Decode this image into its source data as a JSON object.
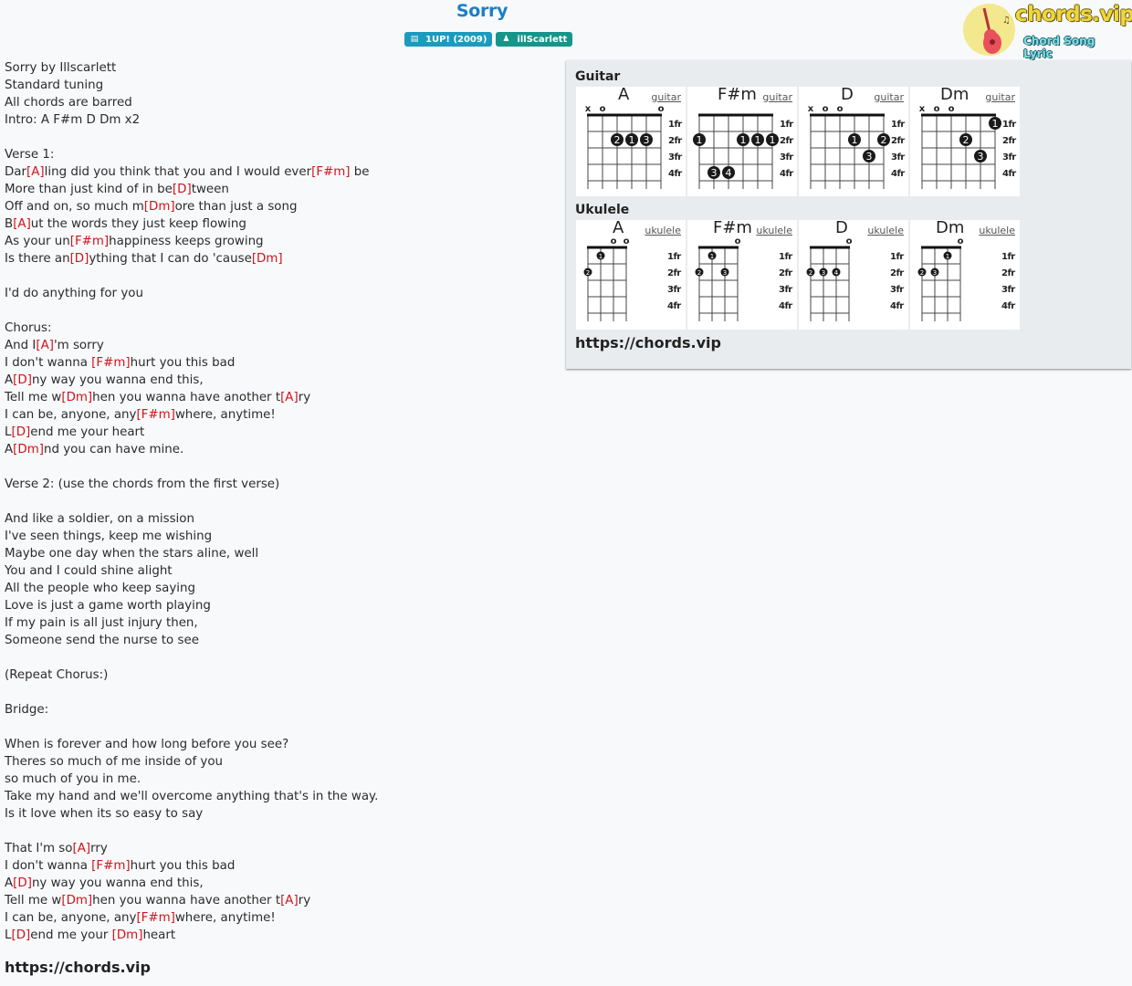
{
  "header": {
    "title": "Sorry",
    "album_badge": {
      "icon": "book-icon",
      "label": "1UP! (2009)"
    },
    "artist_badge": {
      "icon": "user-icon",
      "label": "illScarlett"
    }
  },
  "logo": {
    "title": "chords.vip",
    "subtitle": "Chord Song Lyric",
    "icon": "guitar-icon"
  },
  "colors": {
    "title": "#1b7fc4",
    "chord": "#d0141a",
    "album_badge": "#1b9bbd",
    "artist_badge": "#16958a"
  },
  "lyrics": [
    [
      {
        "t": "Sorry by Illscarlett"
      }
    ],
    [
      {
        "t": "Standard tuning"
      }
    ],
    [
      {
        "t": "All chords are barred"
      }
    ],
    [
      {
        "t": "Intro: A F#m D Dm x2"
      }
    ],
    [],
    [
      {
        "t": "Verse 1:"
      }
    ],
    [
      {
        "t": "Dar"
      },
      {
        "c": "[A]"
      },
      {
        "t": "ling did you think that you and I would ever"
      },
      {
        "c": "[F#m]"
      },
      {
        "t": " be"
      }
    ],
    [
      {
        "t": "More than just kind of in be"
      },
      {
        "c": "[D]"
      },
      {
        "t": "tween"
      }
    ],
    [
      {
        "t": "Off and on, so much m"
      },
      {
        "c": "[Dm]"
      },
      {
        "t": "ore than just a song"
      }
    ],
    [
      {
        "t": "B"
      },
      {
        "c": "[A]"
      },
      {
        "t": "ut the words they just keep flowing"
      }
    ],
    [
      {
        "t": "As your un"
      },
      {
        "c": "[F#m]"
      },
      {
        "t": "happiness keeps growing"
      }
    ],
    [
      {
        "t": "Is there an"
      },
      {
        "c": "[D]"
      },
      {
        "t": "ything that I can do 'cause"
      },
      {
        "c": "[Dm]"
      }
    ],
    [],
    [
      {
        "t": "I'd do anything for you"
      }
    ],
    [],
    [
      {
        "t": "Chorus:"
      }
    ],
    [
      {
        "t": "And I"
      },
      {
        "c": "[A]"
      },
      {
        "t": "'m sorry"
      }
    ],
    [
      {
        "t": "I don't wanna "
      },
      {
        "c": "[F#m]"
      },
      {
        "t": "hurt you this bad"
      }
    ],
    [
      {
        "t": "A"
      },
      {
        "c": "[D]"
      },
      {
        "t": "ny way you wanna end this,"
      }
    ],
    [
      {
        "t": "Tell me w"
      },
      {
        "c": "[Dm]"
      },
      {
        "t": "hen you wanna have another t"
      },
      {
        "c": "[A]"
      },
      {
        "t": "ry"
      }
    ],
    [
      {
        "t": "I can be, anyone, any"
      },
      {
        "c": "[F#m]"
      },
      {
        "t": "where, anytime!"
      }
    ],
    [
      {
        "t": "L"
      },
      {
        "c": "[D]"
      },
      {
        "t": "end me your heart"
      }
    ],
    [
      {
        "t": "A"
      },
      {
        "c": "[Dm]"
      },
      {
        "t": "nd you can have mine."
      }
    ],
    [],
    [
      {
        "t": "Verse 2: (use the chords from the first verse)"
      }
    ],
    [],
    [
      {
        "t": "And like a soldier, on a mission"
      }
    ],
    [
      {
        "t": "I've seen things, keep me wishing"
      }
    ],
    [
      {
        "t": "Maybe one day when the stars aline, well"
      }
    ],
    [
      {
        "t": "You and I could shine alight"
      }
    ],
    [
      {
        "t": "All the people who keep saying"
      }
    ],
    [
      {
        "t": "Love is just a game worth playing"
      }
    ],
    [
      {
        "t": "If my pain is all just injury then,"
      }
    ],
    [
      {
        "t": "Someone send the nurse to see"
      }
    ],
    [],
    [
      {
        "t": "(Repeat Chorus:)"
      }
    ],
    [],
    [
      {
        "t": "Bridge:"
      }
    ],
    [],
    [
      {
        "t": "When is forever and how long before you see?"
      }
    ],
    [
      {
        "t": "Theres so much of me inside of you"
      }
    ],
    [
      {
        "t": "so much of you in me."
      }
    ],
    [
      {
        "t": "Take my hand and we'll overcome anything that's in the way."
      }
    ],
    [
      {
        "t": "Is it love when its so easy to say"
      }
    ],
    [],
    [
      {
        "t": "That I'm so"
      },
      {
        "c": "[A]"
      },
      {
        "t": "rry"
      }
    ],
    [
      {
        "t": "I don't wanna "
      },
      {
        "c": "[F#m]"
      },
      {
        "t": "hurt you this bad"
      }
    ],
    [
      {
        "t": "A"
      },
      {
        "c": "[D]"
      },
      {
        "t": "ny way you wanna end this,"
      }
    ],
    [
      {
        "t": "Tell me w"
      },
      {
        "c": "[Dm]"
      },
      {
        "t": "hen you wanna have another t"
      },
      {
        "c": "[A]"
      },
      {
        "t": "ry"
      }
    ],
    [
      {
        "t": "I can be, anyone, any"
      },
      {
        "c": "[F#m]"
      },
      {
        "t": "where, anytime!"
      }
    ],
    [
      {
        "t": "L"
      },
      {
        "c": "[D]"
      },
      {
        "t": "end me your "
      },
      {
        "c": "[Dm]"
      },
      {
        "t": "heart"
      }
    ]
  ],
  "footer_link": "https://chords.vip",
  "chord_panel": {
    "guitar_heading": "Guitar",
    "ukulele_heading": "Ukulele",
    "link": "https://chords.vip",
    "fret_labels": [
      "1fr",
      "2fr",
      "3fr",
      "4fr"
    ],
    "guitar": [
      {
        "name": "A",
        "type": "guitar",
        "markers": [
          "x",
          "o",
          "",
          "",
          "",
          "o"
        ],
        "dots": [
          {
            "string": 3,
            "fret": 2,
            "finger": "2"
          },
          {
            "string": 4,
            "fret": 2,
            "finger": "1"
          },
          {
            "string": 5,
            "fret": 2,
            "finger": "3"
          }
        ]
      },
      {
        "name": "F#m",
        "type": "guitar",
        "markers": [
          "",
          "",
          "",
          "",
          "",
          ""
        ],
        "dots": [
          {
            "string": 1,
            "fret": 2,
            "finger": "1"
          },
          {
            "string": 2,
            "fret": 4,
            "finger": "3"
          },
          {
            "string": 3,
            "fret": 4,
            "finger": "4"
          },
          {
            "string": 4,
            "fret": 2,
            "finger": "1"
          },
          {
            "string": 5,
            "fret": 2,
            "finger": "1"
          },
          {
            "string": 6,
            "fret": 2,
            "finger": "1"
          }
        ]
      },
      {
        "name": "D",
        "type": "guitar",
        "markers": [
          "x",
          "o",
          "o",
          "",
          "",
          ""
        ],
        "dots": [
          {
            "string": 4,
            "fret": 2,
            "finger": "1"
          },
          {
            "string": 5,
            "fret": 3,
            "finger": "3"
          },
          {
            "string": 6,
            "fret": 2,
            "finger": "2"
          }
        ]
      },
      {
        "name": "Dm",
        "type": "guitar",
        "markers": [
          "x",
          "o",
          "o",
          "",
          "",
          ""
        ],
        "dots": [
          {
            "string": 4,
            "fret": 2,
            "finger": "2"
          },
          {
            "string": 5,
            "fret": 3,
            "finger": "3"
          },
          {
            "string": 6,
            "fret": 1,
            "finger": "1"
          }
        ]
      }
    ],
    "ukulele": [
      {
        "name": "A",
        "type": "ukulele",
        "markers": [
          "",
          "",
          "o",
          "o"
        ],
        "dots": [
          {
            "string": 1,
            "fret": 2,
            "finger": "2"
          },
          {
            "string": 2,
            "fret": 1,
            "finger": "1"
          }
        ]
      },
      {
        "name": "F#m",
        "type": "ukulele",
        "markers": [
          "",
          "",
          "",
          "o"
        ],
        "dots": [
          {
            "string": 1,
            "fret": 2,
            "finger": "2"
          },
          {
            "string": 2,
            "fret": 1,
            "finger": "1"
          },
          {
            "string": 3,
            "fret": 2,
            "finger": "3"
          }
        ]
      },
      {
        "name": "D",
        "type": "ukulele",
        "markers": [
          "",
          "",
          "",
          "o"
        ],
        "dots": [
          {
            "string": 1,
            "fret": 2,
            "finger": "2"
          },
          {
            "string": 2,
            "fret": 2,
            "finger": "3"
          },
          {
            "string": 3,
            "fret": 2,
            "finger": "4"
          }
        ]
      },
      {
        "name": "Dm",
        "type": "ukulele",
        "markers": [
          "",
          "",
          "",
          "o"
        ],
        "dots": [
          {
            "string": 1,
            "fret": 2,
            "finger": "2"
          },
          {
            "string": 2,
            "fret": 2,
            "finger": "3"
          },
          {
            "string": 3,
            "fret": 1,
            "finger": "1"
          }
        ]
      }
    ]
  }
}
